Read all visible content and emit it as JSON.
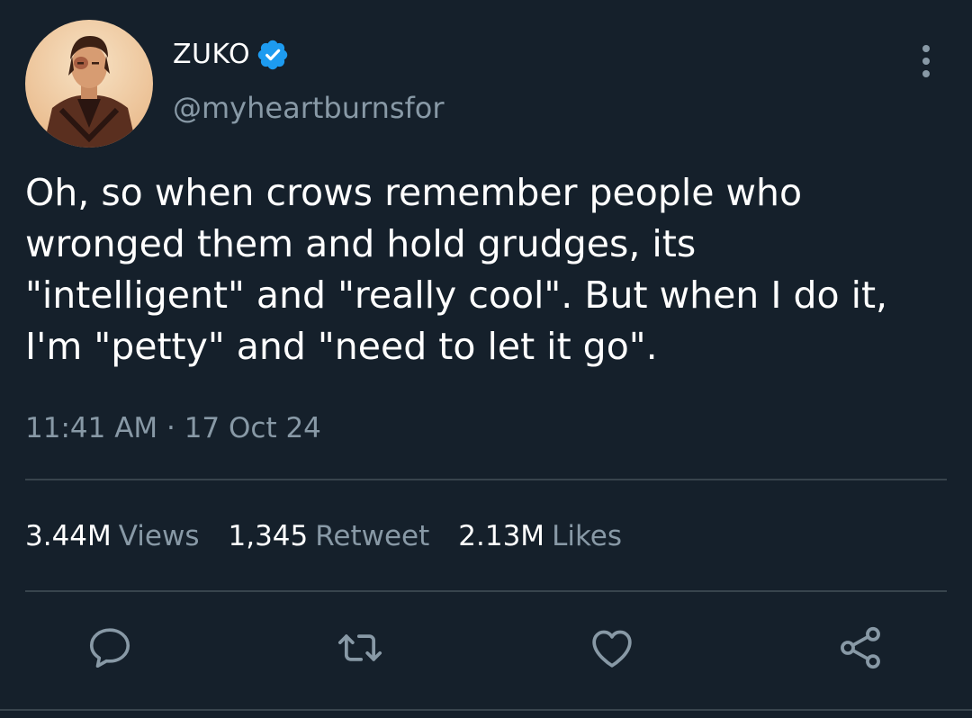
{
  "author": {
    "display_name": "ZUKO",
    "handle": "@myheartburnsfor",
    "verified": true
  },
  "tweet": {
    "text": "Oh, so when crows remember people who\nwronged them and hold grudges, its\n\"intelligent\" and \"really cool\". But when I do it,\nI'm \"petty\" and \"need to let it go\".",
    "timestamp": "11:41 AM · 17 Oct 24"
  },
  "stats": {
    "views_count": "3.44M",
    "views_label": "Views",
    "retweets_count": "1,345",
    "retweets_label": "Retweet",
    "likes_count": "2.13M",
    "likes_label": "Likes"
  },
  "icons": {
    "more": "more-vertical-icon",
    "verified": "verified-badge-icon",
    "reply": "reply-icon",
    "retweet": "retweet-icon",
    "like": "heart-icon",
    "share": "share-icon"
  },
  "colors": {
    "background": "#15202b",
    "text_primary": "#ffffff",
    "text_secondary": "#8899a6",
    "divider": "#38444d",
    "verified_blue": "#1d9bf0"
  }
}
